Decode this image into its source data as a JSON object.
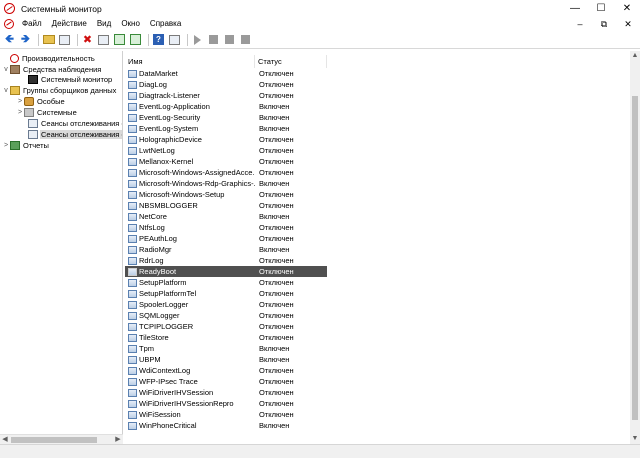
{
  "window": {
    "title": "Системный монитор",
    "colors": {
      "selected_row": "#505050",
      "accent_icon": "#cc0000"
    }
  },
  "menu": {
    "items": [
      "Файл",
      "Действие",
      "Вид",
      "Окно",
      "Справка"
    ]
  },
  "tree": {
    "items": [
      {
        "label": "Производительность",
        "icon": "perf-icon",
        "expander": ""
      },
      {
        "label": "Средства наблюдения",
        "icon": "tools-icon",
        "expander": "v"
      },
      {
        "label": "Системный монитор",
        "icon": "monitor-icon",
        "expander": ""
      },
      {
        "label": "Группы сборщиков данных",
        "icon": "group-icon",
        "expander": "v"
      },
      {
        "label": "Особые",
        "icon": "special-icon",
        "expander": ">"
      },
      {
        "label": "Системные",
        "icon": "system-icon",
        "expander": ">"
      },
      {
        "label": "Сеансы отслеживания с",
        "icon": "trace-icon",
        "expander": ""
      },
      {
        "label": "Сеансы отслеживания с",
        "icon": "trace-icon",
        "expander": ""
      },
      {
        "label": "Отчеты",
        "icon": "reports-icon",
        "expander": ">"
      }
    ]
  },
  "list": {
    "columns": {
      "name": "Имя",
      "status": "Статус"
    },
    "rows": [
      {
        "name": "DataMarket",
        "status": "Отключен"
      },
      {
        "name": "DiagLog",
        "status": "Отключен"
      },
      {
        "name": "Diagtrack-Listener",
        "status": "Отключен"
      },
      {
        "name": "EventLog-Application",
        "status": "Включен"
      },
      {
        "name": "EventLog-Security",
        "status": "Включен"
      },
      {
        "name": "EventLog-System",
        "status": "Включен"
      },
      {
        "name": "HolographicDevice",
        "status": "Отключен"
      },
      {
        "name": "LwtNetLog",
        "status": "Отключен"
      },
      {
        "name": "Mellanox-Kernel",
        "status": "Отключен"
      },
      {
        "name": "Microsoft-Windows-AssignedAcce...",
        "status": "Отключен"
      },
      {
        "name": "Microsoft-Windows-Rdp-Graphics-...",
        "status": "Включен"
      },
      {
        "name": "Microsoft-Windows-Setup",
        "status": "Отключен"
      },
      {
        "name": "NBSMBLOGGER",
        "status": "Отключен"
      },
      {
        "name": "NetCore",
        "status": "Включен"
      },
      {
        "name": "NtfsLog",
        "status": "Отключен"
      },
      {
        "name": "PEAuthLog",
        "status": "Отключен"
      },
      {
        "name": "RadioMgr",
        "status": "Включен"
      },
      {
        "name": "RdrLog",
        "status": "Отключен"
      },
      {
        "name": "ReadyBoot",
        "status": "Отключен",
        "selected": true
      },
      {
        "name": "SetupPlatform",
        "status": "Отключен"
      },
      {
        "name": "SetupPlatformTel",
        "status": "Отключен"
      },
      {
        "name": "SpoolerLogger",
        "status": "Отключен"
      },
      {
        "name": "SQMLogger",
        "status": "Отключен"
      },
      {
        "name": "TCPIPLOGGER",
        "status": "Отключен"
      },
      {
        "name": "TileStore",
        "status": "Отключен"
      },
      {
        "name": "Tpm",
        "status": "Включен"
      },
      {
        "name": "UBPM",
        "status": "Включен"
      },
      {
        "name": "WdiContextLog",
        "status": "Отключен"
      },
      {
        "name": "WFP-IPsec Trace",
        "status": "Отключен"
      },
      {
        "name": "WiFiDriverIHVSession",
        "status": "Отключен"
      },
      {
        "name": "WiFiDriverIHVSessionRepro",
        "status": "Отключен"
      },
      {
        "name": "WiFiSession",
        "status": "Отключен"
      },
      {
        "name": "WinPhoneCritical",
        "status": "Включен"
      }
    ]
  }
}
